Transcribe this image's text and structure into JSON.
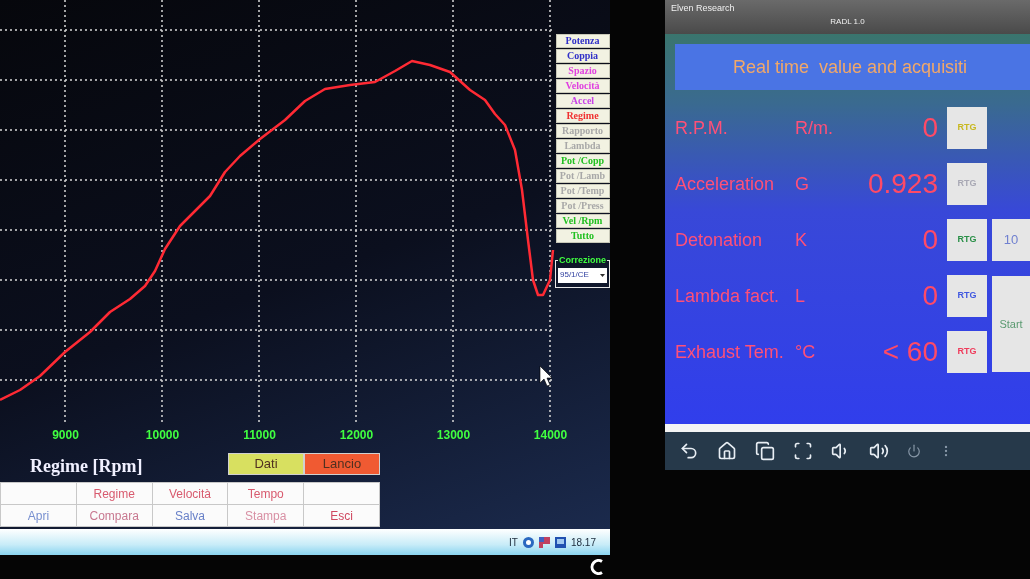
{
  "left_screen": {
    "chart": {
      "x_axis": {
        "ticks": [
          "9000",
          "10000",
          "11000",
          "12000",
          "13000",
          "14000"
        ],
        "label": "Regime [Rpm]"
      }
    },
    "side_buttons": [
      {
        "label": "Potenza",
        "color": "#3030c8"
      },
      {
        "label": "Coppia",
        "color": "#3030c8"
      },
      {
        "label": "Spazio",
        "color": "#e040e0"
      },
      {
        "label": "Velocità",
        "color": "#e040e0"
      },
      {
        "label": "Accel",
        "color": "#c840e8"
      },
      {
        "label": "Regime",
        "color": "#f03030"
      },
      {
        "label": "Rapporto",
        "color": "#a8a8a8"
      },
      {
        "label": "Lambda",
        "color": "#a8a8a8"
      },
      {
        "label": "Pot /Copp",
        "color": "#20c020"
      },
      {
        "label": "Pot /Lamb",
        "color": "#a8a8a8"
      },
      {
        "label": "Pot /Temp",
        "color": "#a8a8a8"
      },
      {
        "label": "Pot /Press",
        "color": "#a8a8a8"
      },
      {
        "label": "Vel /Rpm",
        "color": "#20c020"
      },
      {
        "label": "Tutto",
        "color": "#20c020"
      }
    ],
    "correction": {
      "title": "Correzione",
      "value": "95/1/CE"
    },
    "header_buttons": [
      {
        "label": "Dati",
        "color": "#d8e060"
      },
      {
        "label": "Lancio",
        "color": "#f05a32"
      }
    ],
    "button_rows": [
      [
        {
          "kind": "blank"
        },
        {
          "kind": "button",
          "label": "Regime",
          "color": "#d85a6e"
        },
        {
          "kind": "button",
          "label": "Velocità",
          "color": "#d85a6e"
        },
        {
          "kind": "button",
          "label": "Tempo",
          "color": "#d85a6e"
        },
        {
          "kind": "blank"
        }
      ],
      [
        {
          "kind": "button",
          "label": "Apri",
          "color": "#7890d0"
        },
        {
          "kind": "button",
          "label": "Compara",
          "color": "#c87890"
        },
        {
          "kind": "button",
          "label": "Salva",
          "color": "#6880c8"
        },
        {
          "kind": "button",
          "label": "Stampa",
          "color": "#d890a4"
        },
        {
          "kind": "button",
          "label": "Esci",
          "color": "#d04860"
        }
      ]
    ],
    "taskbar": {
      "language": "IT",
      "clock": "18.17"
    }
  },
  "right_screen": {
    "title_bar": {
      "vendor": "Elven Research",
      "app": "RADL 1.0"
    },
    "header": "Real time  value and acquisiti",
    "readings": [
      {
        "label": "R.P.M.",
        "unit": "R/m.",
        "value": "0",
        "button": {
          "label": "RTG",
          "color": "#c8b820"
        }
      },
      {
        "label": "Acceleration",
        "unit": "G",
        "value": "0.923",
        "button": {
          "label": "RTG",
          "color": "#a8a8b4"
        }
      },
      {
        "label": "Detonation",
        "unit": "K",
        "value": "0",
        "button": {
          "label": "RTG",
          "color": "#2a9048"
        }
      },
      {
        "label": "Lambda fact.",
        "unit": "L",
        "value": "0",
        "button": {
          "label": "RTG",
          "color": "#4058e0"
        }
      },
      {
        "label": "Exhaust Tem.",
        "unit": "°C",
        "value": "< 60",
        "button": {
          "label": "RTG",
          "color": "#f03c5c"
        }
      }
    ],
    "side_buttons": [
      "10",
      "Start"
    ]
  }
}
